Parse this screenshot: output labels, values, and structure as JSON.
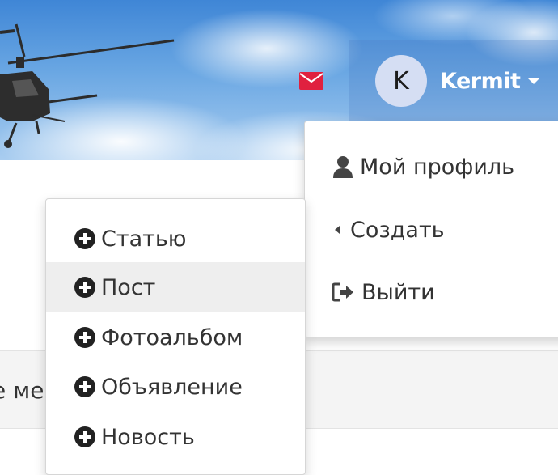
{
  "header": {
    "mail_icon": "envelope-icon",
    "mail_color": "#e0213f",
    "user": {
      "initial": "K",
      "name": "Kermit"
    }
  },
  "user_menu": {
    "items": [
      {
        "label": "Мой профиль",
        "icon": "user-icon"
      },
      {
        "label": "Создать",
        "icon": "caret-left-icon"
      },
      {
        "label": "Выйти",
        "icon": "sign-out-icon"
      }
    ]
  },
  "create_menu": {
    "items": [
      {
        "label": "Статью",
        "icon": "plus-circle-icon"
      },
      {
        "label": "Пост",
        "icon": "plus-circle-icon"
      },
      {
        "label": "Фотоальбом",
        "icon": "plus-circle-icon"
      },
      {
        "label": "Объявление",
        "icon": "plus-circle-icon"
      },
      {
        "label": "Новость",
        "icon": "plus-circle-icon"
      }
    ],
    "highlighted": "Пост"
  },
  "background": {
    "partial_text": "е ме"
  }
}
